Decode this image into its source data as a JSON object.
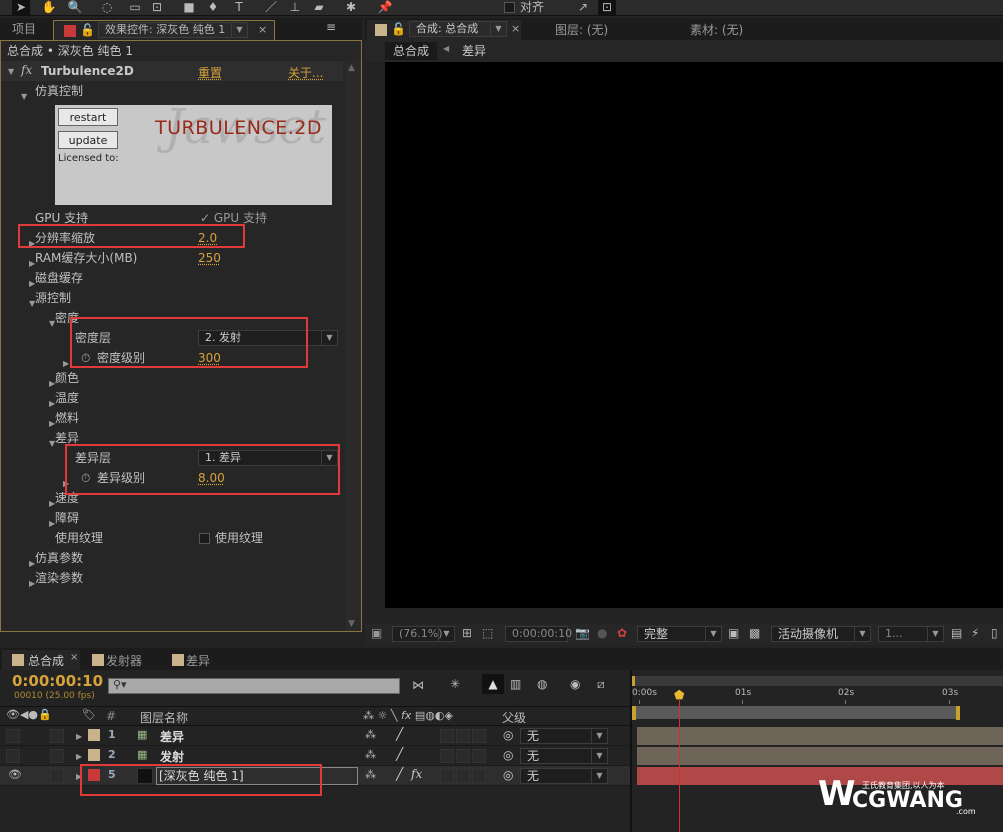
{
  "toolbar": {
    "align_label": "对齐"
  },
  "left_panel": {
    "tabs": [
      {
        "label": "项目"
      },
      {
        "label": "效果控件: 深灰色 纯色 1"
      }
    ],
    "breadcrumb": "总合成 • 深灰色 纯色 1",
    "effect": {
      "fx": "fx",
      "name": "Turbulence2D",
      "reset": "重置",
      "about": "关于..."
    },
    "plugin": {
      "restart": "restart",
      "update": "update",
      "logo": "TURBULENCE.2D",
      "watermark": "Jawset",
      "licensed": "Licensed to:"
    },
    "rows": [
      {
        "label": "仿真控制",
        "level": 0,
        "tri": "down"
      },
      {
        "label": "GPU 支持",
        "level": 1,
        "tri": "",
        "check": "✓ GPU 支持"
      },
      {
        "label": "分辨率缩放",
        "level": 1,
        "tri": "right",
        "value": "2.0"
      },
      {
        "label": "RAM缓存大小(MB)",
        "level": 1,
        "tri": "right",
        "value": "250"
      },
      {
        "label": "磁盘缓存",
        "level": 1,
        "tri": "right"
      },
      {
        "label": "源控制",
        "level": 1,
        "tri": "down"
      },
      {
        "label": "密度",
        "level": 2,
        "tri": "down"
      },
      {
        "label": "密度层",
        "level": 3,
        "tri": "",
        "select": "2. 发射"
      },
      {
        "label": "密度级别",
        "level": 3,
        "tri": "right",
        "stopwatch": true,
        "value": "300"
      },
      {
        "label": "颜色",
        "level": 2,
        "tri": "right"
      },
      {
        "label": "温度",
        "level": 2,
        "tri": "right"
      },
      {
        "label": "燃料",
        "level": 2,
        "tri": "right"
      },
      {
        "label": "差异",
        "level": 2,
        "tri": "down"
      },
      {
        "label": "差异层",
        "level": 3,
        "tri": "",
        "select": "1. 差异"
      },
      {
        "label": "差异级别",
        "level": 3,
        "tri": "right",
        "stopwatch": true,
        "value": "8.00"
      },
      {
        "label": "速度",
        "level": 2,
        "tri": "right"
      },
      {
        "label": "障碍",
        "level": 2,
        "tri": "right"
      },
      {
        "label": "使用纹理",
        "level": 2,
        "tri": "",
        "checkbox": "使用纹理"
      },
      {
        "label": "仿真参数",
        "level": 1,
        "tri": "right"
      },
      {
        "label": "渲染参数",
        "level": 1,
        "tri": "right"
      }
    ]
  },
  "viewer": {
    "tabs": [
      {
        "label": "合成: 总合成"
      },
      {
        "label": "图层: (无)"
      },
      {
        "label": "素材: (无)"
      }
    ],
    "breadcrumbs": [
      "总合成",
      "差异"
    ],
    "zoom": "(76.1%)",
    "timecode": "0:00:00:10",
    "quality": "完整",
    "camera": "活动摄像机",
    "views": "1..."
  },
  "timeline": {
    "tabs": [
      {
        "label": "总合成"
      },
      {
        "label": "发射器"
      },
      {
        "label": "差异"
      }
    ],
    "tab_colors": [
      "#c8b38a",
      "#c8b38a",
      "#c8b38a"
    ],
    "timecode": "0:00:00:10",
    "frame_info": "00010 (25.00 fps)",
    "search_placeholder": "",
    "col_num": "#",
    "col_name": "图层名称",
    "col_parent": "父级",
    "ruler": [
      "0:00s",
      "01s",
      "02s",
      "03s"
    ],
    "layers": [
      {
        "num": "1",
        "name": "差异",
        "color": "#c8b38a",
        "parent": "无",
        "fx": "",
        "visible": false
      },
      {
        "num": "2",
        "name": "发射",
        "color": "#c8b38a",
        "parent": "无",
        "fx": "",
        "visible": false
      },
      {
        "num": "5",
        "name": "[深灰色 纯色 1]",
        "color": "#c83a3a",
        "parent": "无",
        "fx": "fx",
        "visible": true
      }
    ]
  },
  "watermark": {
    "brand": "CGWANG",
    "slogan": "王氏教育集团,以人为本",
    "suffix": ".com"
  }
}
